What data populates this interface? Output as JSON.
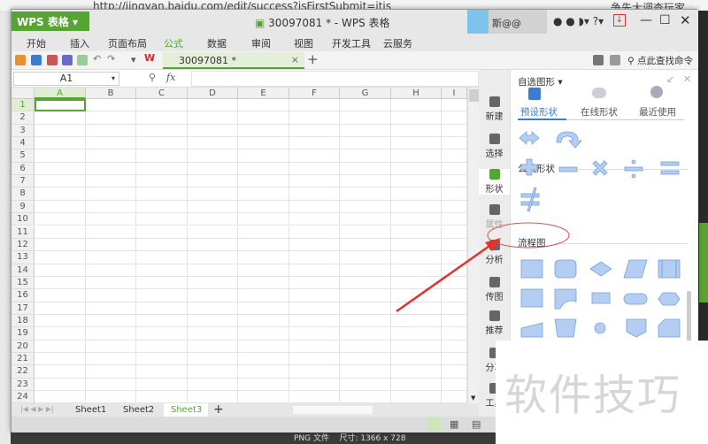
{
  "browser": {
    "url": "http://jingyan.baidu.com/edit/success?isFirstSubmit=itis",
    "right_text": "争先大调查玩家",
    "bottom_text1": "PNG 文件",
    "bottom_text2": "尺寸: 1366 x 728"
  },
  "app": {
    "brand": "WPS 表格",
    "title": "30097081 * - WPS 表格",
    "user": "斯@@",
    "accent": "#55a532"
  },
  "menu": [
    "开始",
    "插入",
    "页面布局",
    "公式",
    "数据",
    "审阅",
    "视图",
    "开发工具",
    "云服务"
  ],
  "toolbar": {
    "doc_tab": "30097081 *",
    "search": "点此查找命令"
  },
  "formula": {
    "name_box": "A1",
    "fx": "fx",
    "value": ""
  },
  "grid": {
    "columns": [
      "A",
      "B",
      "C",
      "D",
      "E",
      "F",
      "G",
      "H",
      "I"
    ],
    "rows": [
      1,
      2,
      3,
      4,
      5,
      6,
      7,
      8,
      9,
      10,
      11,
      12,
      13,
      14,
      15,
      16,
      17,
      18,
      19,
      20,
      21,
      22,
      23,
      24
    ],
    "selected": "A1"
  },
  "sheets": {
    "tabs": [
      "Sheet1",
      "Sheet2",
      "Sheet3"
    ],
    "active": "Sheet3"
  },
  "side_strip": [
    "新建",
    "选择",
    "形状",
    "属性",
    "分析",
    "传图",
    "推荐",
    "分享",
    "工具"
  ],
  "panel": {
    "title": "自选图形",
    "tabs": [
      "预设形状",
      "在线形状",
      "最近使用"
    ],
    "active_tab": "预设形状",
    "sections": {
      "formula": "公式形状",
      "flow": "流程图"
    }
  },
  "watermark": "软件技巧"
}
